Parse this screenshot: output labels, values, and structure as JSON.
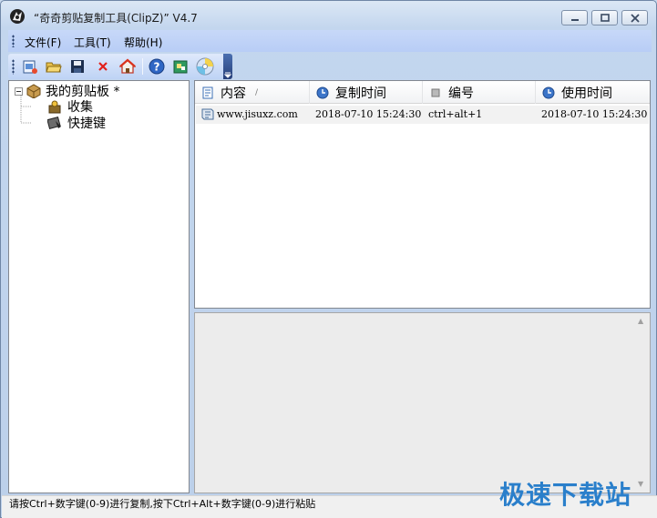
{
  "window": {
    "title": "“奇奇剪贴复制工具(ClipZ)” V4.7"
  },
  "menu": {
    "items": [
      {
        "label": "文件(F)"
      },
      {
        "label": "工具(T)"
      },
      {
        "label": "帮助(H)"
      }
    ]
  },
  "toolbar": {
    "buttons": [
      {
        "icon": "new-icon"
      },
      {
        "icon": "open-folder-icon"
      },
      {
        "icon": "save-icon"
      },
      {
        "icon": "delete-icon"
      },
      {
        "icon": "home-icon"
      },
      {
        "icon": "help-icon"
      },
      {
        "icon": "plugin-icon"
      },
      {
        "icon": "cd-icon"
      }
    ]
  },
  "tree": {
    "root": "我的剪贴板 *",
    "children": [
      "收集",
      "快捷键"
    ]
  },
  "list": {
    "columns": [
      "内容",
      "复制时间",
      "编号",
      "使用时间"
    ],
    "sort_indicator": "/",
    "rows": [
      {
        "content": "www.jisuxz.com",
        "copy_time": "2018-07-10 15:24:30",
        "number": "ctrl+alt+1",
        "use_time": "2018-07-10 15:24:30"
      }
    ]
  },
  "status": {
    "text": "请按Ctrl+数字键(0-9)进行复制,按下Ctrl+Alt+数字键(0-9)进行粘贴"
  },
  "watermark": {
    "text": "极速下载站"
  },
  "colors": {
    "menubar": "#c7d8f8",
    "watermark": "#2a7fcb",
    "selected_row": "#f2f2f2"
  }
}
